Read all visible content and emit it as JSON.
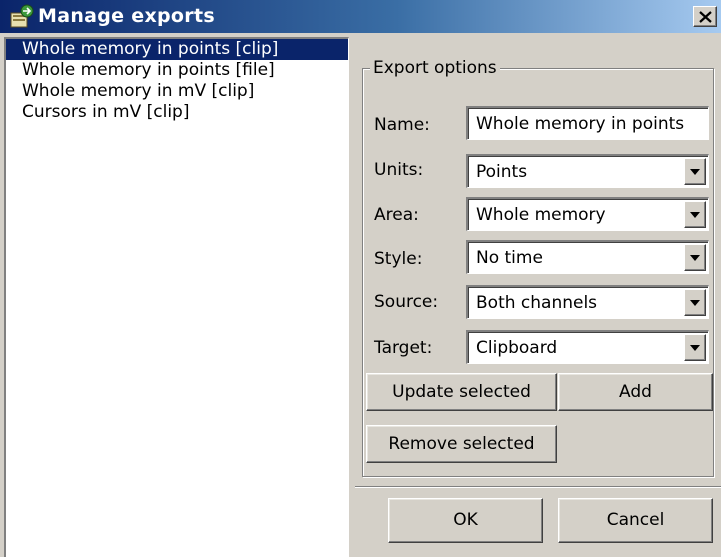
{
  "window": {
    "title": "Manage exports",
    "close_symbol": "×"
  },
  "exports_list": {
    "items": [
      "Whole memory in points [clip]",
      "Whole memory in points [file]",
      "Whole memory in mV [clip]",
      "Cursors in mV [clip]"
    ],
    "selected_index": 0
  },
  "export_options": {
    "caption": "Export options",
    "name": {
      "label": "Name:",
      "value": "Whole memory in points"
    },
    "units": {
      "label": "Units:",
      "value": "Points"
    },
    "area": {
      "label": "Area:",
      "value": "Whole memory"
    },
    "style": {
      "label": "Style:",
      "value": "No time"
    },
    "source": {
      "label": "Source:",
      "value": "Both channels"
    },
    "target": {
      "label": "Target:",
      "value": "Clipboard"
    }
  },
  "buttons": {
    "update_selected": "Update selected",
    "add": "Add",
    "remove_selected": "Remove selected",
    "ok": "OK",
    "cancel": "Cancel"
  },
  "icons": {
    "app": "export-app-icon",
    "close": "close-icon",
    "dropdown": "chevron-down-icon"
  },
  "colors": {
    "titlebar_start": "#0a246a",
    "titlebar_end": "#a6caf0",
    "selection": "#0a246a",
    "face": "#d4d0c8"
  }
}
